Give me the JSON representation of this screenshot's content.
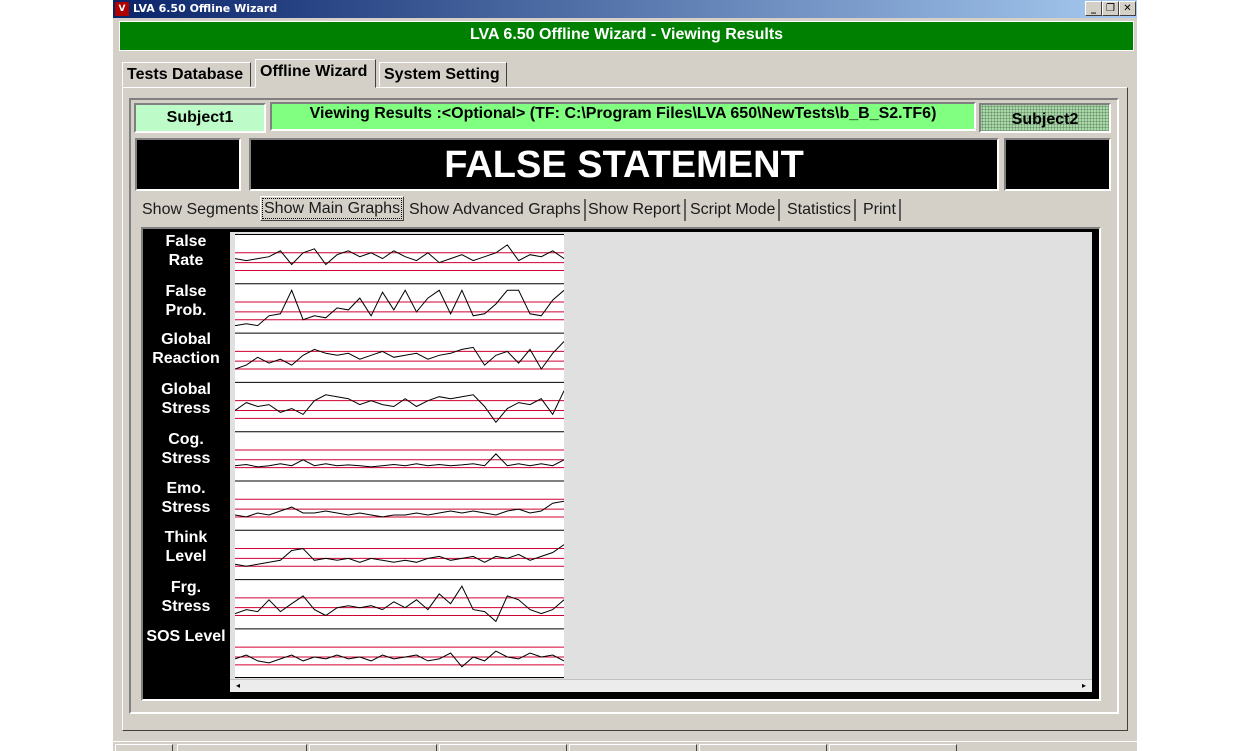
{
  "window": {
    "title": "LVA 6.50 Offline Wizard",
    "header": "LVA 6.50 Offline Wizard - Viewing Results",
    "controls": {
      "minimize": "_",
      "restore": "❐",
      "close": "✕"
    }
  },
  "main_tabs": [
    {
      "label": "Tests Database"
    },
    {
      "label": "Offline Wizard"
    },
    {
      "label": "System Setting"
    }
  ],
  "subject1": "Subject1",
  "subject2": "Subject2",
  "viewing_results": "Viewing Results :<Optional>  (TF: C:\\Program Files\\LVA 650\\NewTests\\b_B_S2.TF6)",
  "statement": "FALSE STATEMENT",
  "sub_tabs": [
    {
      "label": "Show Segments"
    },
    {
      "label": "Show Main Graphs"
    },
    {
      "label": "Show Advanced Graphs"
    },
    {
      "label": "Show Report"
    },
    {
      "label": "Script Mode"
    },
    {
      "label": "Statistics"
    },
    {
      "label": "Print"
    }
  ],
  "graphs": [
    {
      "line1": "False",
      "line2": "Rate",
      "values": [
        0.5,
        0.45,
        0.5,
        0.55,
        0.7,
        0.35,
        0.65,
        0.75,
        0.35,
        0.6,
        0.7,
        0.55,
        0.65,
        0.5,
        0.7,
        0.55,
        0.45,
        0.65,
        0.4,
        0.5,
        0.6,
        0.45,
        0.55,
        0.65,
        0.85,
        0.45,
        0.6,
        0.55,
        0.7,
        0.5
      ]
    },
    {
      "line1": "False",
      "line2": "Prob.",
      "values": [
        0.05,
        0.1,
        0.05,
        0.3,
        0.35,
        0.95,
        0.2,
        0.3,
        0.25,
        0.5,
        0.45,
        0.75,
        0.3,
        0.9,
        0.45,
        0.95,
        0.4,
        0.75,
        0.95,
        0.35,
        0.95,
        0.3,
        0.35,
        0.6,
        0.95,
        0.95,
        0.35,
        0.3,
        0.7,
        0.95
      ]
    },
    {
      "line1": "Global",
      "line2": "Reaction",
      "values": [
        0.2,
        0.3,
        0.5,
        0.35,
        0.45,
        0.3,
        0.55,
        0.7,
        0.6,
        0.55,
        0.6,
        0.45,
        0.55,
        0.65,
        0.5,
        0.55,
        0.6,
        0.45,
        0.55,
        0.6,
        0.7,
        0.75,
        0.3,
        0.55,
        0.65,
        0.35,
        0.7,
        0.2,
        0.6,
        0.9
      ]
    },
    {
      "line1": "Global",
      "line2": "Stress",
      "values": [
        0.4,
        0.6,
        0.5,
        0.55,
        0.35,
        0.45,
        0.3,
        0.65,
        0.8,
        0.75,
        0.7,
        0.55,
        0.65,
        0.55,
        0.5,
        0.7,
        0.5,
        0.65,
        0.75,
        0.7,
        0.75,
        0.8,
        0.5,
        0.1,
        0.45,
        0.6,
        0.55,
        0.7,
        0.3,
        0.9
      ]
    },
    {
      "line1": "Cog.",
      "line2": "Stress",
      "values": [
        0.25,
        0.28,
        0.22,
        0.25,
        0.3,
        0.25,
        0.4,
        0.25,
        0.3,
        0.25,
        0.27,
        0.25,
        0.22,
        0.25,
        0.28,
        0.25,
        0.3,
        0.25,
        0.28,
        0.25,
        0.27,
        0.3,
        0.25,
        0.55,
        0.25,
        0.3,
        0.25,
        0.3,
        0.25,
        0.4
      ]
    },
    {
      "line1": "Emo.",
      "line2": "Stress",
      "values": [
        0.25,
        0.2,
        0.3,
        0.25,
        0.35,
        0.45,
        0.3,
        0.3,
        0.35,
        0.3,
        0.25,
        0.3,
        0.25,
        0.2,
        0.25,
        0.25,
        0.3,
        0.25,
        0.3,
        0.35,
        0.3,
        0.35,
        0.3,
        0.25,
        0.35,
        0.4,
        0.3,
        0.35,
        0.55,
        0.6
      ]
    },
    {
      "line1": "Think",
      "line2": "Level",
      "values": [
        0.25,
        0.2,
        0.25,
        0.3,
        0.35,
        0.6,
        0.65,
        0.35,
        0.4,
        0.35,
        0.4,
        0.3,
        0.4,
        0.35,
        0.3,
        0.35,
        0.3,
        0.4,
        0.45,
        0.35,
        0.4,
        0.45,
        0.3,
        0.45,
        0.4,
        0.5,
        0.35,
        0.45,
        0.55,
        0.75
      ]
    },
    {
      "line1": "Frg.",
      "line2": "Stress",
      "values": [
        0.25,
        0.35,
        0.3,
        0.6,
        0.3,
        0.5,
        0.7,
        0.35,
        0.2,
        0.4,
        0.45,
        0.4,
        0.45,
        0.35,
        0.55,
        0.4,
        0.6,
        0.35,
        0.75,
        0.5,
        0.95,
        0.35,
        0.3,
        0.05,
        0.7,
        0.6,
        0.35,
        0.25,
        0.35,
        0.6
      ]
    },
    {
      "line1": "SOS Level",
      "line2": "",
      "values": [
        0.35,
        0.45,
        0.3,
        0.25,
        0.35,
        0.45,
        0.3,
        0.4,
        0.35,
        0.45,
        0.35,
        0.4,
        0.3,
        0.45,
        0.35,
        0.4,
        0.45,
        0.3,
        0.35,
        0.5,
        0.15,
        0.4,
        0.3,
        0.55,
        0.4,
        0.35,
        0.5,
        0.4,
        0.45,
        0.3
      ]
    }
  ],
  "scroll": {
    "left": "◂",
    "right": "▸"
  }
}
